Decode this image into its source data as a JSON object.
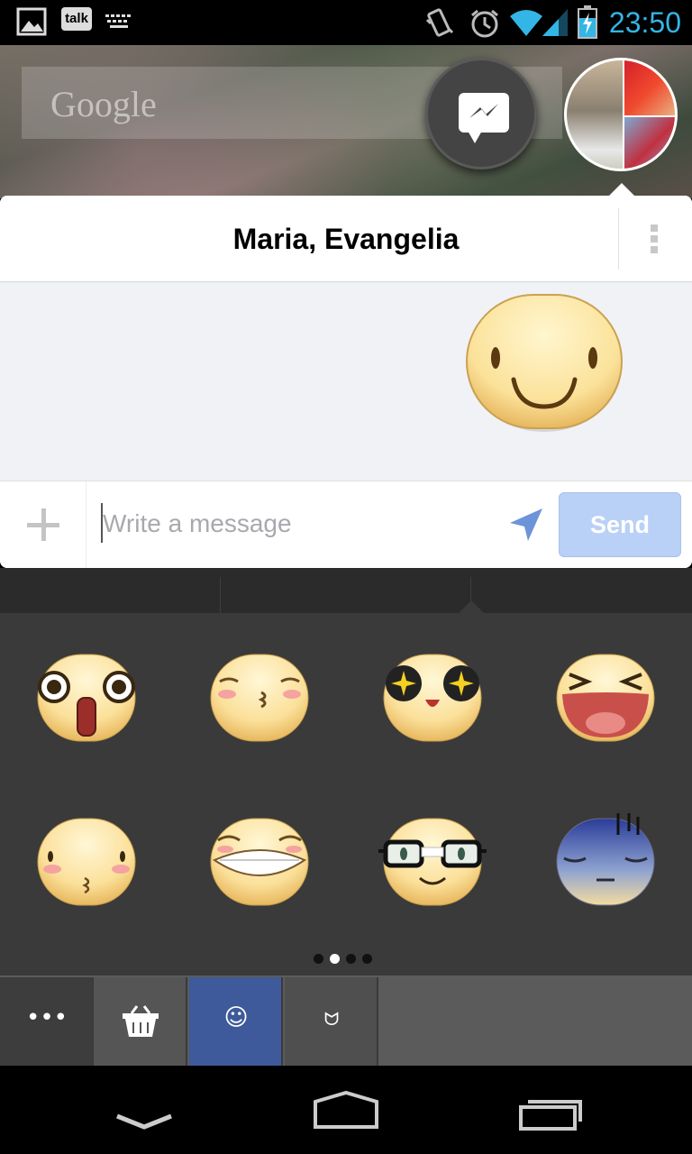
{
  "status_bar": {
    "talk_label": "talk",
    "time": "23:50",
    "icons": [
      "gallery-icon",
      "talk-icon",
      "keyboard-icon",
      "vibrate-icon",
      "alarm-icon",
      "wifi-icon",
      "signal-icon",
      "battery-charging-icon"
    ]
  },
  "home": {
    "search_logo": "Google"
  },
  "chat": {
    "title": "Maria, Evangelia",
    "input_placeholder": "Write a message",
    "send_label": "Send"
  },
  "stickers": {
    "pack": "smiley-faces",
    "items": [
      "shocked",
      "kissing-blush",
      "star-eyes",
      "laughing",
      "whistle",
      "grin",
      "glasses",
      "gloomy"
    ],
    "page_count": 4,
    "active_page": 2
  },
  "tray_tabs": [
    {
      "name": "more",
      "glyph": "•••"
    },
    {
      "name": "sticker-store",
      "glyph": ""
    },
    {
      "name": "emoji",
      "glyph": "☺"
    },
    {
      "name": "cat-stickers",
      "glyph": "ᗢ"
    }
  ],
  "colors": {
    "clock": "#33b5e5",
    "send_disabled": "#b9d0f7",
    "active_tab": "#3e5a9a"
  }
}
